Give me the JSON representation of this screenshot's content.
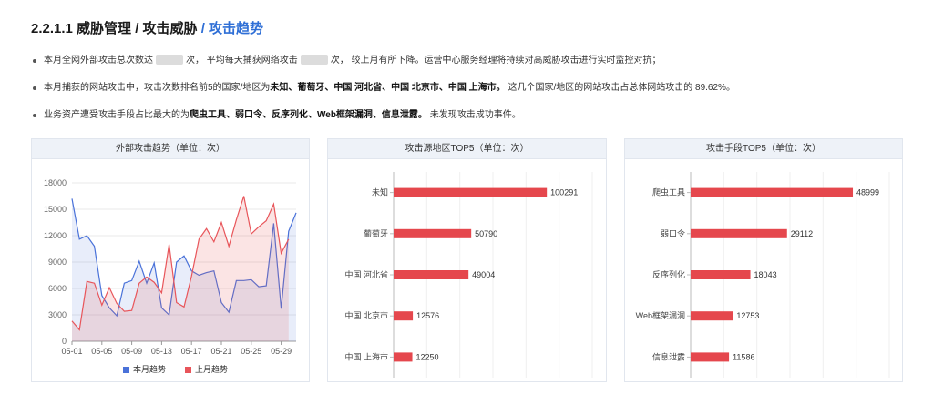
{
  "header": {
    "title_main": "2.2.1.1 威胁管理 / 攻击威胁",
    "title_accent": " / 攻击趋势"
  },
  "bullets": {
    "b1_a": "本月全网外部攻击总次数达",
    "b1_b": "次，   平均每天捕获网络攻击",
    "b1_c": "次，   较上月有所下降。运营中心服务经理将持续对高威胁攻击进行实时监控对抗；",
    "b2_a": "本月捕获的网站攻击中，攻击次数排名前5的国家/地区为",
    "b2_b": "未知、葡萄牙、中国 河北省、中国 北京市、中国 上海市。",
    "b2_c": " 这几个国家/地区的网站攻击占总体网站攻击的 89.62%。",
    "b3_a": "业务资产遭受攻击手段占比最大的为",
    "b3_b": "爬虫工具、弱口令、反序列化、Web框架漏洞、信息泄露。",
    "b3_c": " 未发现攻击成功事件。"
  },
  "colors": {
    "blue": "#4a72d9",
    "red": "#e8555a",
    "bar": "#e5474d",
    "grid": "#e8e8e8"
  },
  "chart_data": [
    {
      "type": "line",
      "title": "外部攻击趋势（单位：次）",
      "x": [
        "05-01",
        "05-02",
        "05-03",
        "05-04",
        "05-05",
        "05-06",
        "05-07",
        "05-08",
        "05-09",
        "05-10",
        "05-11",
        "05-12",
        "05-13",
        "05-14",
        "05-15",
        "05-16",
        "05-17",
        "05-18",
        "05-19",
        "05-20",
        "05-21",
        "05-22",
        "05-23",
        "05-24",
        "05-25",
        "05-26",
        "05-27",
        "05-28",
        "05-29",
        "05-30",
        "05-31"
      ],
      "xticks": [
        "05-01",
        "05-05",
        "05-09",
        "05-13",
        "05-17",
        "05-21",
        "05-25",
        "05-29"
      ],
      "yticks": [
        0,
        3000,
        6000,
        9000,
        12000,
        15000,
        18000
      ],
      "ylim": [
        0,
        18000
      ],
      "legend": "bottom",
      "series": [
        {
          "name": "本月趋势",
          "values": [
            16200,
            11600,
            12000,
            10800,
            5200,
            3800,
            2900,
            6600,
            6900,
            9100,
            6600,
            8900,
            3800,
            3000,
            9000,
            9700,
            8000,
            7500,
            7800,
            8000,
            4400,
            3300,
            6900,
            6900,
            7000,
            6200,
            6300,
            13400,
            3700,
            12500,
            14600
          ]
        },
        {
          "name": "上月趋势",
          "values": [
            2300,
            1300,
            6800,
            6600,
            4100,
            6100,
            4300,
            3400,
            3500,
            6600,
            7300,
            6700,
            5500,
            11000,
            4400,
            3900,
            7400,
            11600,
            12800,
            11300,
            13500,
            10800,
            13800,
            16500,
            12200,
            13000,
            13700,
            15600,
            10000,
            11600,
            null
          ]
        }
      ]
    },
    {
      "type": "bar",
      "title": "攻击源地区TOP5（单位：次）",
      "categories": [
        "未知",
        "葡萄牙",
        "中国 河北省",
        "中国 北京市",
        "中国 上海市"
      ],
      "values": [
        100291,
        50790,
        49004,
        12576,
        12250
      ],
      "xlim": [
        0,
        130000
      ]
    },
    {
      "type": "bar",
      "title": "攻击手段TOP5（单位：次）",
      "categories": [
        "爬虫工具",
        "弱口令",
        "反序列化",
        "Web框架漏洞",
        "信息泄露"
      ],
      "values": [
        48999,
        29112,
        18043,
        12753,
        11586
      ],
      "xlim": [
        0,
        60000
      ]
    }
  ]
}
